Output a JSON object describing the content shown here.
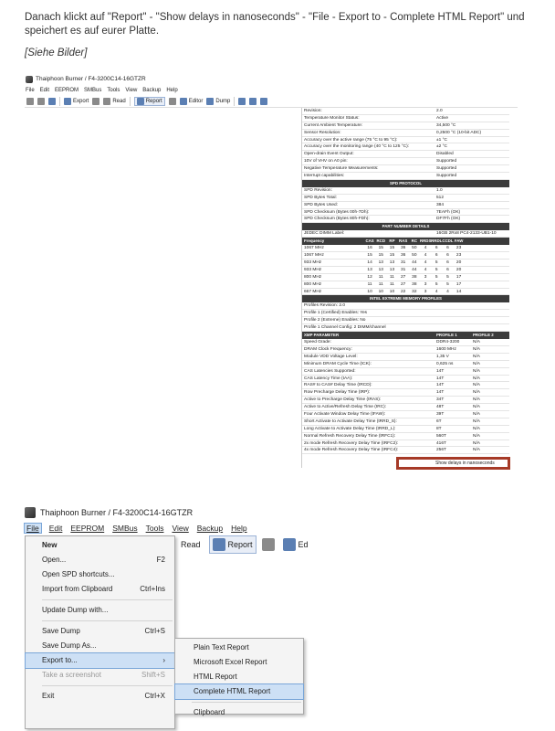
{
  "intro": "Danach klickt auf \"Report\" - \"Show delays in nanoseconds\" - \"File - Export to - Complete HTML Report\" und speichert es auf eurer Platte.",
  "caption": "[Siehe Bilder]",
  "shot1": {
    "title": "Thaiphoon Burner / F4-3200C14-16GTZR",
    "menu": [
      "File",
      "Edit",
      "EEPROM",
      "SMBus",
      "Tools",
      "View",
      "Backup",
      "Help"
    ],
    "toolbar": {
      "export": "Export",
      "read": "Read",
      "report": "Report",
      "editor": "Editor",
      "dump": "Dump"
    },
    "report_top": [
      [
        "Revision:",
        "2.0"
      ],
      [
        "Temperature Monitor Status:",
        "Active"
      ],
      [
        "Current Ambient Temperature:",
        "34,500 °C"
      ],
      [
        "Sensor Resolution:",
        "0,2500 °C (10-bit ADC)"
      ],
      [
        "Accuracy over the active range (75 °C to 95 °C):",
        "±1 °C"
      ],
      [
        "Accuracy over the monitoring range (40 °C to 125 °C):",
        "±2 °C"
      ],
      [
        "Open-drain Event Output:",
        "Disabled"
      ],
      [
        "10V of VHV on A0 pin:",
        "Supported"
      ],
      [
        "Negative Temperature Measurements:",
        "Supported"
      ],
      [
        "Interrupt capabilities:",
        "Supported"
      ]
    ],
    "spd_header": "SPD PROTOCOL",
    "spd_rows": [
      [
        "SPD Revision:",
        "1.0"
      ],
      [
        "SPD Bytes Total:",
        "512"
      ],
      [
        "SPD Bytes Used:",
        "384"
      ],
      [
        "SPD Checksum (Bytes 00h-7Dh):",
        "7EAFh (OK)"
      ],
      [
        "SPD Checksum (Bytes 80h-FDh):",
        "DF7Fh (OK)"
      ]
    ],
    "part_header": "PART NUMBER DETAILS",
    "part_rows": [
      [
        "JEDEC DIMM Label:",
        "16GB 2Rx8 PC4-2133-UB1-10"
      ]
    ],
    "freq_headers": [
      "Frequency",
      "CAS",
      "RCD",
      "RP",
      "RAS",
      "RC",
      "RRDS",
      "RRDL",
      "CCDL",
      "FAW"
    ],
    "freq_rows": [
      [
        "1067 MHz",
        "16",
        "15",
        "15",
        "36",
        "50",
        "4",
        "6",
        "6",
        "23"
      ],
      [
        "1067 MHz",
        "15",
        "15",
        "15",
        "36",
        "50",
        "4",
        "6",
        "6",
        "23"
      ],
      [
        "933 MHz",
        "14",
        "13",
        "13",
        "31",
        "44",
        "4",
        "5",
        "6",
        "20"
      ],
      [
        "933 MHz",
        "13",
        "13",
        "13",
        "31",
        "44",
        "4",
        "5",
        "6",
        "20"
      ],
      [
        "800 MHz",
        "12",
        "11",
        "11",
        "27",
        "38",
        "3",
        "5",
        "5",
        "17"
      ],
      [
        "800 MHz",
        "11",
        "11",
        "11",
        "27",
        "38",
        "3",
        "5",
        "5",
        "17"
      ],
      [
        "667 MHz",
        "10",
        "10",
        "10",
        "22",
        "32",
        "3",
        "4",
        "4",
        "14"
      ]
    ],
    "xmp_section": "INTEL EXTREME MEMORY PROFILES",
    "xmp_info": [
      "Profiles Revision: 2.0",
      "Profile 1 (Certified) Enables: Yes",
      "Profile 2 (Extreme) Enables: No",
      "Profile 1 Channel Config: 2 DIMM/channel"
    ],
    "xmp_headers": [
      "XMP PARAMETER",
      "PROFILE 1",
      "PROFILE 2"
    ],
    "xmp_rows": [
      [
        "Speed Grade:",
        "DDR4-3200",
        "N/A"
      ],
      [
        "DRAM Clock Frequency:",
        "1600 MHz",
        "N/A"
      ],
      [
        "Module VDD Voltage Level:",
        "1,35 V",
        "N/A"
      ],
      [
        "Minimum DRAM Cycle Time (tCK):",
        "0,625 ns",
        "N/A"
      ],
      [
        "CAS Latencies Supported:",
        "14T",
        "N/A"
      ],
      [
        "CAS Latency Time (tAA):",
        "14T",
        "N/A"
      ],
      [
        "RAS# to CAS# Delay Time (tRCD):",
        "14T",
        "N/A"
      ],
      [
        "Row Precharge Delay Time (tRP):",
        "14T",
        "N/A"
      ],
      [
        "Active to Precharge Delay Time (tRAS):",
        "34T",
        "N/A"
      ],
      [
        "Active to Active/Refresh Delay Time (tRC):",
        "48T",
        "N/A"
      ],
      [
        "Four Activate Window Delay Time (tFAW):",
        "39T",
        "N/A"
      ],
      [
        "Short Activate to Activate Delay Time (tRRD_S):",
        "6T",
        "N/A"
      ],
      [
        "Long Activate to Activate Delay Time (tRRD_L):",
        "8T",
        "N/A"
      ],
      [
        "Normal Refresh Recovery Delay Time (tRFC1):",
        "560T",
        "N/A"
      ],
      [
        "2x mode Refresh Recovery Delay Time (tRFC2):",
        "416T",
        "N/A"
      ],
      [
        "4x mode Refresh Recovery Delay Time (tRFC4):",
        "256T",
        "N/A"
      ]
    ],
    "show_delays": "Show delays in nanoseconds"
  },
  "shot2": {
    "title": "Thaiphoon Burner / F4-3200C14-16GTZR",
    "menu": [
      "File",
      "Edit",
      "EEPROM",
      "SMBus",
      "Tools",
      "View",
      "Backup",
      "Help"
    ],
    "toolbar": {
      "read": "Read",
      "report": "Report",
      "editor": "Ed"
    },
    "file_menu": [
      {
        "label": "New",
        "shortcut": ""
      },
      {
        "label": "Open...",
        "shortcut": "F2"
      },
      {
        "label": "Open SPD shortcuts...",
        "shortcut": ""
      },
      {
        "label": "Import from Clipboard",
        "shortcut": "Ctrl+Ins"
      },
      {
        "label": "Update Dump with...",
        "shortcut": ""
      },
      {
        "label": "Save Dump",
        "shortcut": "Ctrl+S"
      },
      {
        "label": "Save Dump As...",
        "shortcut": ""
      },
      {
        "label": "Export to...",
        "shortcut": "›"
      },
      {
        "label": "Take a screenshot",
        "shortcut": "Shift+S"
      },
      {
        "label": "Exit",
        "shortcut": "Ctrl+X"
      }
    ],
    "export_menu": [
      "Plain Text Report",
      "Microsoft Excel Report",
      "HTML Report",
      "Complete HTML Report",
      "Clipboard"
    ]
  }
}
